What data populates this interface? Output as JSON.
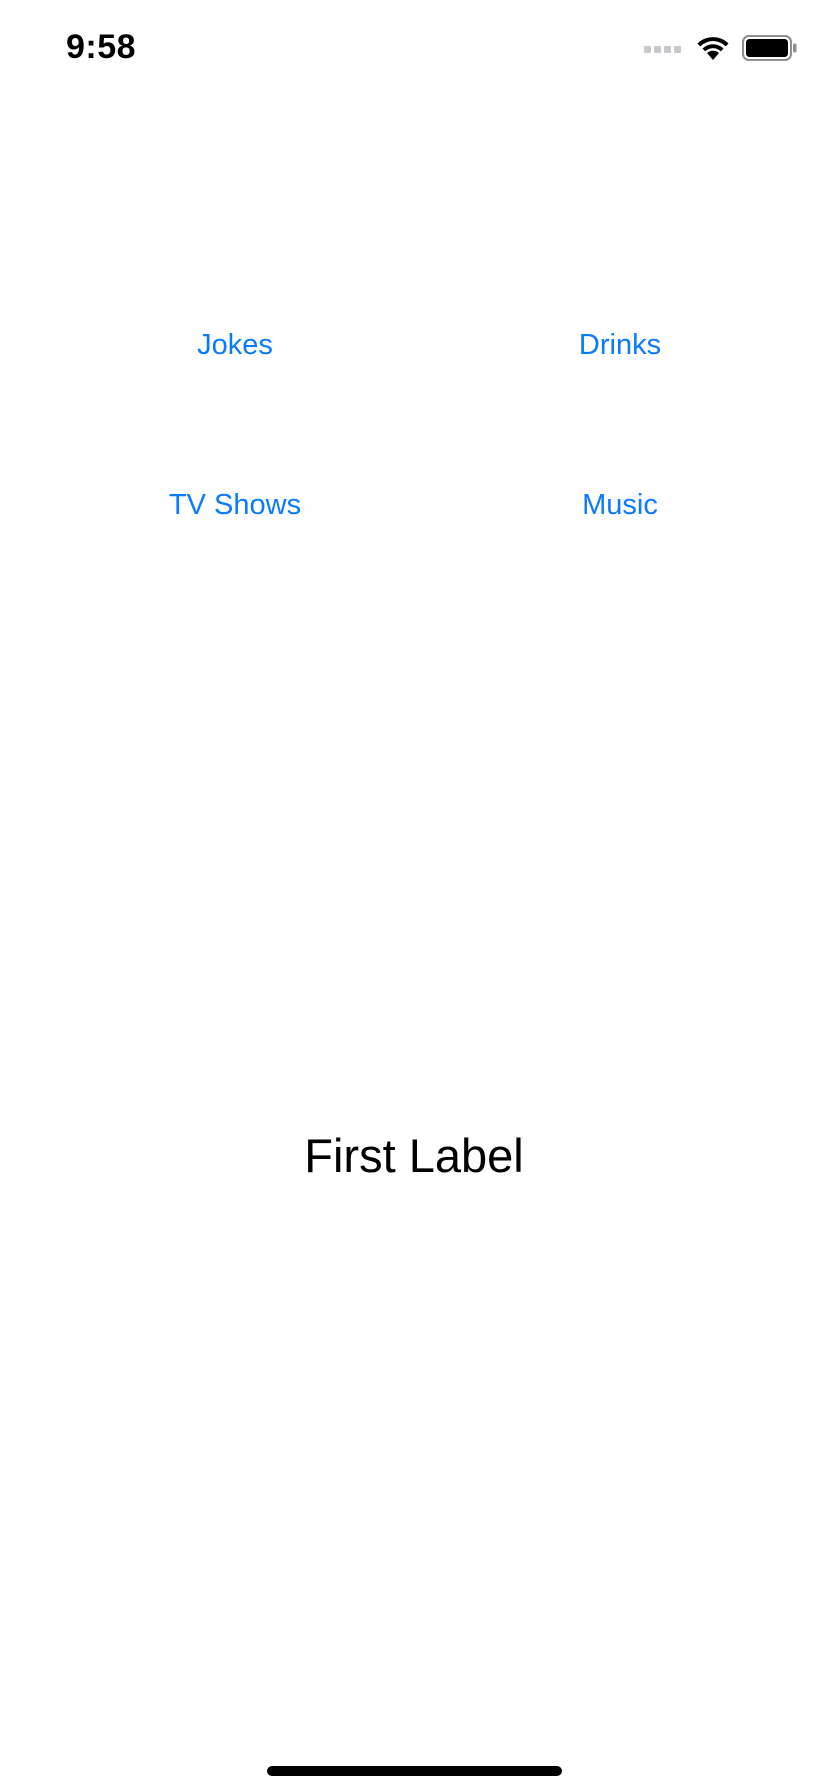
{
  "status_bar": {
    "time": "9:58",
    "icons": [
      "cellular-signal-icon",
      "wifi-icon",
      "battery-icon"
    ]
  },
  "buttons": {
    "jokes": "Jokes",
    "drinks": "Drinks",
    "tv_shows": "TV Shows",
    "music": "Music"
  },
  "main": {
    "label": "First Label"
  },
  "colors": {
    "accent": "#0a7aff",
    "text": "#000000",
    "background": "#ffffff",
    "signal_inactive": "#c7c7cc"
  }
}
